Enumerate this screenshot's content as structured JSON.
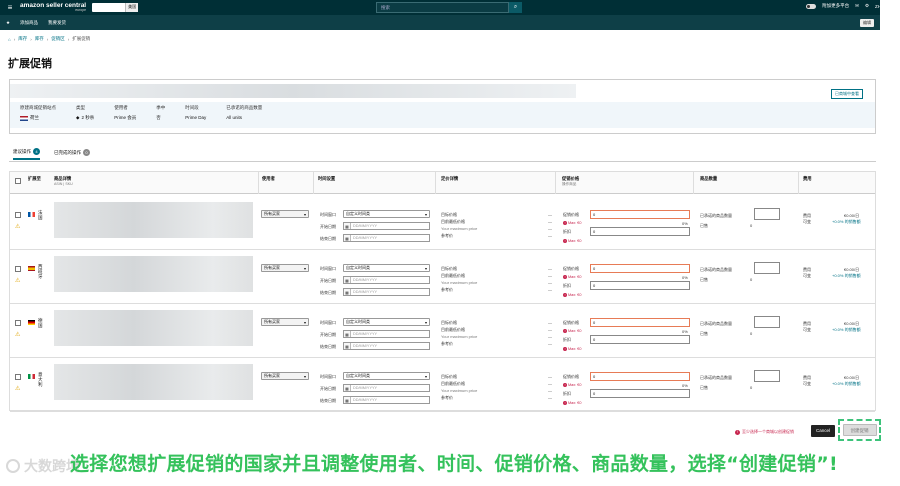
{
  "topbar": {
    "logo": "amazon seller central",
    "logo_sub": "europe",
    "store_button": "美国",
    "search_placeholder": "搜索",
    "right_label": "附加更多平台",
    "language": "ZH",
    "help": "帮助"
  },
  "navbar": {
    "items": [
      "添加商品",
      "我要发货"
    ],
    "edit": "编辑"
  },
  "breadcrumb": [
    "库存",
    "库存",
    "促销区",
    "扩展促销"
  ],
  "page_title": "扩展促销",
  "summary": {
    "view_list_button": "已商城中查看",
    "cols": [
      {
        "h": "原建商城促销站点",
        "v": "荷兰"
      },
      {
        "h": "类型",
        "v": "2 秒杀"
      },
      {
        "h": "使用者",
        "v": "Prime 会员"
      },
      {
        "h": "季中",
        "v": "否"
      },
      {
        "h": "时间段",
        "v": "Prime Day"
      },
      {
        "h": "已承诺的商品数量",
        "v": "All units"
      }
    ]
  },
  "tabs": [
    {
      "label": "建议操作",
      "count": "4"
    },
    {
      "label": "已完成的操作",
      "count": "0"
    }
  ],
  "table": {
    "headers": {
      "expand": "扩展至",
      "product": "商品详情",
      "product_sub": "ASIN | SKU",
      "user": "使用者",
      "time": "时间设置",
      "pricing": "定价详情",
      "promo": "促销价格",
      "promo_sub": "操作商品",
      "qty": "商品数量",
      "fee": "费用"
    },
    "rows": [
      {
        "country": "法国",
        "user": "所有买家",
        "flag": "fr"
      },
      {
        "country": "西班牙",
        "user": "所有买家",
        "flag": "es"
      },
      {
        "country": "德国",
        "user": "所有买家",
        "flag": "de"
      },
      {
        "country": "意大利",
        "user": "所有买家",
        "flag": "it"
      }
    ],
    "time_labels": {
      "window": "时间窗口",
      "window_value": "自定义时间类",
      "start": "开始日期",
      "end": "结束日期",
      "date_placeholder": "DD/MM/YYYY"
    },
    "pricing_labels": [
      "目标价格",
      "目前最低价格",
      "Your maximum price",
      "参考价"
    ],
    "pricing_value": "—",
    "promo_labels": {
      "price": "促销价格",
      "discount": "折扣",
      "value": "0",
      "error": "Max: €0",
      "percent": "0%"
    },
    "qty_labels": {
      "committed": "已承诺的商品数量",
      "sold": "已售",
      "sold_value": "0"
    },
    "fee_labels": {
      "label1": "费用",
      "label2": "可变",
      "amount": "€0.00/日",
      "variable": "+0.0% 的销售额"
    }
  },
  "footer": {
    "error": "至少选择一个商城以创建促销",
    "cancel": "Cancel",
    "create": "创建促销"
  },
  "caption": "选择您想扩展促销的国家并且调整使用者、时间、促销价格、商品数量，选择“创建促销”!",
  "watermark": "大数跨境"
}
